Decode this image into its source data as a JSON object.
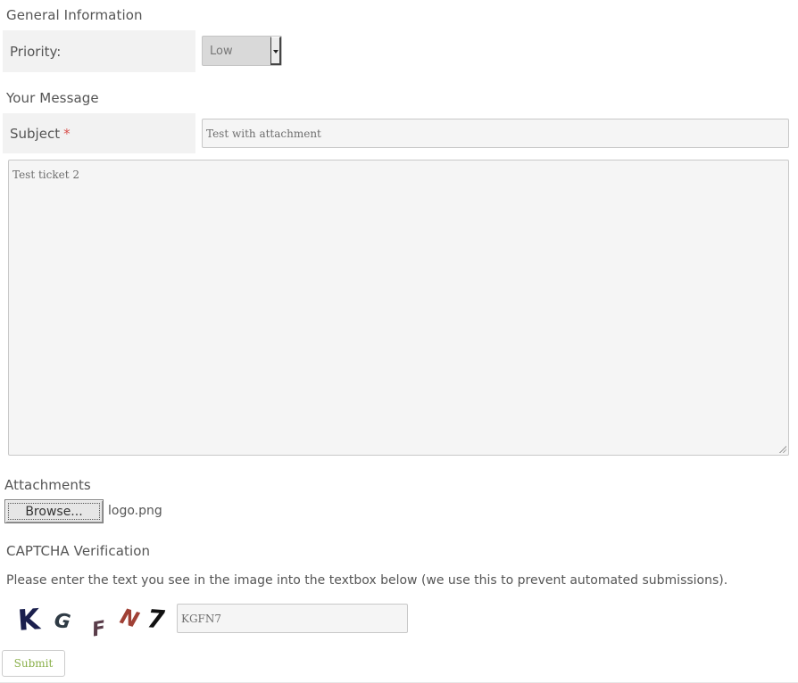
{
  "general": {
    "heading": "General Information",
    "priority_label": "Priority:",
    "priority_value": "Low"
  },
  "message": {
    "heading": "Your Message",
    "subject_label": "Subject",
    "required_marker": "*",
    "subject_value": "Test with attachment",
    "body_value": "Test ticket 2"
  },
  "attachments": {
    "heading": "Attachments",
    "browse_label": "Browse...",
    "file_name": "logo.png"
  },
  "captcha": {
    "heading": "CAPTCHA Verification",
    "instructions": "Please enter the text you see in the image into the textbox below (we use this to prevent automated submissions).",
    "image_chars": [
      "K",
      "G",
      "F",
      "N",
      "7"
    ],
    "image_colors": [
      "#1a1f4d",
      "#2f3b45",
      "#5a3d4a",
      "#a04035",
      "#111111"
    ],
    "input_value": "KGFN7"
  },
  "form": {
    "submit_label": "Submit"
  }
}
